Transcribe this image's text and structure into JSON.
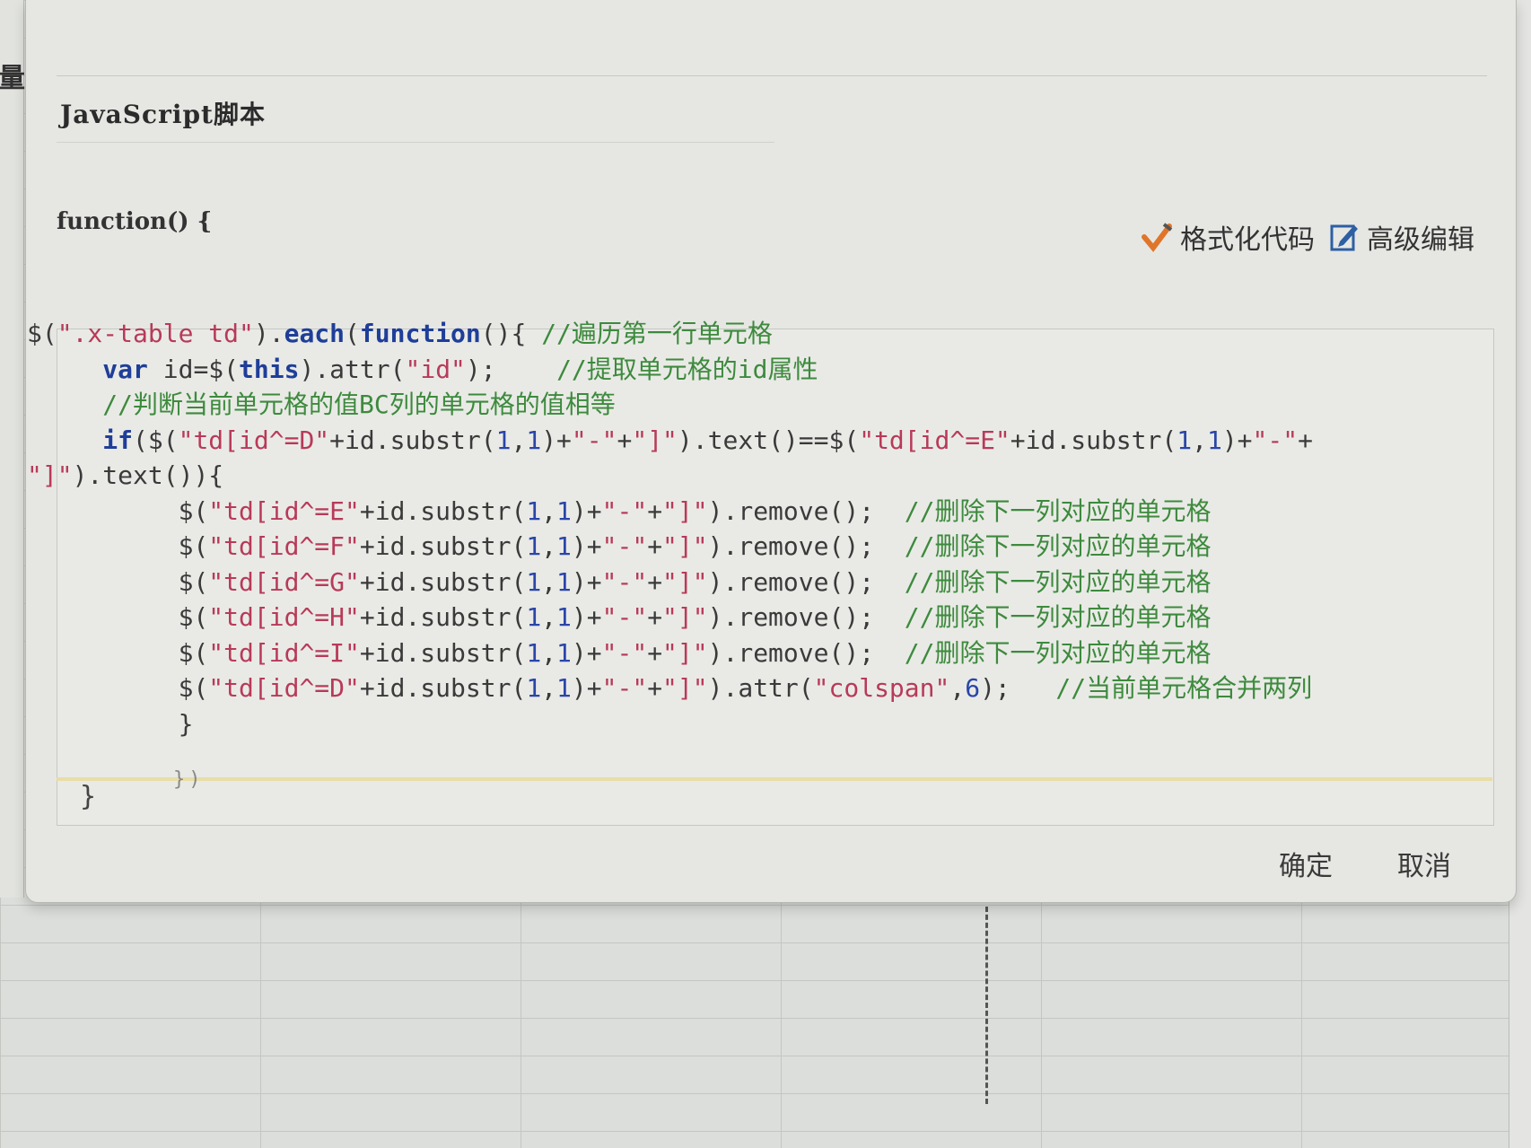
{
  "dialog": {
    "title": "JavaScript脚本",
    "function_header": "function() {",
    "function_footer": "}",
    "toolbar": {
      "format_code": "格式化代码",
      "advanced_edit": "高级编辑"
    },
    "buttons": {
      "confirm": "确定",
      "cancel": "取消"
    }
  },
  "background": {
    "left_strip_glyph": "量"
  },
  "code_lines": [
    "$(\".x-table td\").each(function(){ //遍历第一行单元格",
    "     var id=$(this).attr(\"id\");    //提取单元格的id属性",
    "     //判断当前单元格的值BC列的单元格的值相等",
    "     if($(\"td[id^=D\"+id.substr(1,1)+\"-\"+\"]\").text()==$(\"td[id^=E\"+id.substr(1,1)+\"-\"+",
    "\"]\").text()){",
    "          $(\"td[id^=E\"+id.substr(1,1)+\"-\"+\"]\").remove();  //删除下一列对应的单元格",
    "          $(\"td[id^=F\"+id.substr(1,1)+\"-\"+\"]\").remove();  //删除下一列对应的单元格",
    "          $(\"td[id^=G\"+id.substr(1,1)+\"-\"+\"]\").remove();  //删除下一列对应的单元格",
    "          $(\"td[id^=H\"+id.substr(1,1)+\"-\"+\"]\").remove();  //删除下一列对应的单元格",
    "          $(\"td[id^=I\"+id.substr(1,1)+\"-\"+\"]\").remove();  //删除下一列对应的单元格",
    "          $(\"td[id^=D\"+id.substr(1,1)+\"-\"+\"]\").attr(\"colspan\",6);   //当前单元格合并两列",
    "          }"
  ],
  "code_partial_line": "})"
}
